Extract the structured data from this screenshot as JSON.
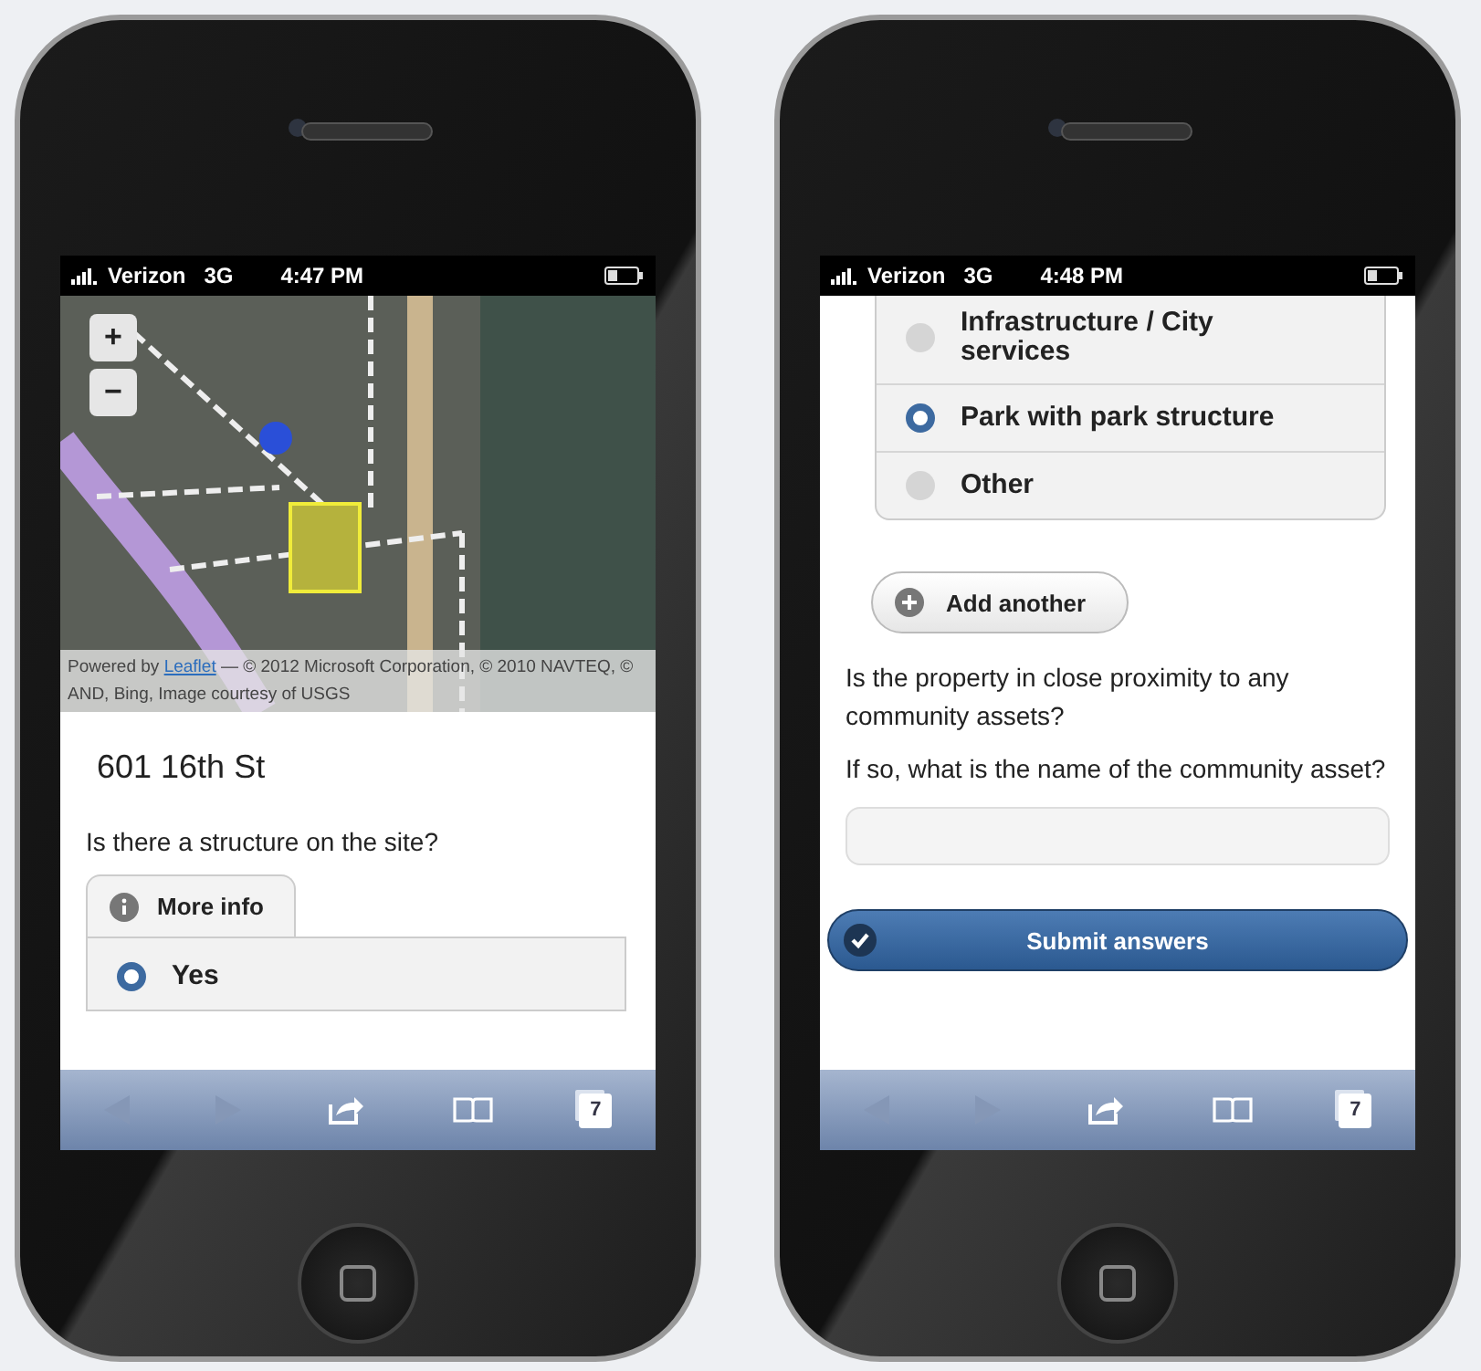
{
  "phones": [
    {
      "kind": "map_form",
      "status_bar": {
        "carrier": "Verizon",
        "network": "3G",
        "time": "4:47 PM"
      },
      "map": {
        "zoom_in": "+",
        "zoom_out": "−",
        "attribution_prefix": "Powered by",
        "attribution_link": "Leaflet",
        "attribution_rest": "— © 2012 Microsoft Corporation, © 2010 NAVTEQ, © AND, Bing, Image courtesy of USGS"
      },
      "address": "601 16th St",
      "question": "Is there a structure on the site?",
      "more_info": "More info",
      "options": [
        {
          "label": "Yes",
          "selected": true
        }
      ],
      "toolbar": {
        "tabs_count": "7"
      }
    },
    {
      "kind": "form",
      "status_bar": {
        "carrier": "Verizon",
        "network": "3G",
        "time": "4:48 PM"
      },
      "options": [
        {
          "label": "Infrastructure / City services",
          "selected": false
        },
        {
          "label": "Park with park structure",
          "selected": true
        },
        {
          "label": "Other",
          "selected": false
        }
      ],
      "add_button": "Add another",
      "questions": [
        "Is the property in close proximity to any community assets?",
        "If so, what is the name of the community asset?"
      ],
      "submit": "Submit answers",
      "toolbar": {
        "tabs_count": "7"
      }
    }
  ]
}
